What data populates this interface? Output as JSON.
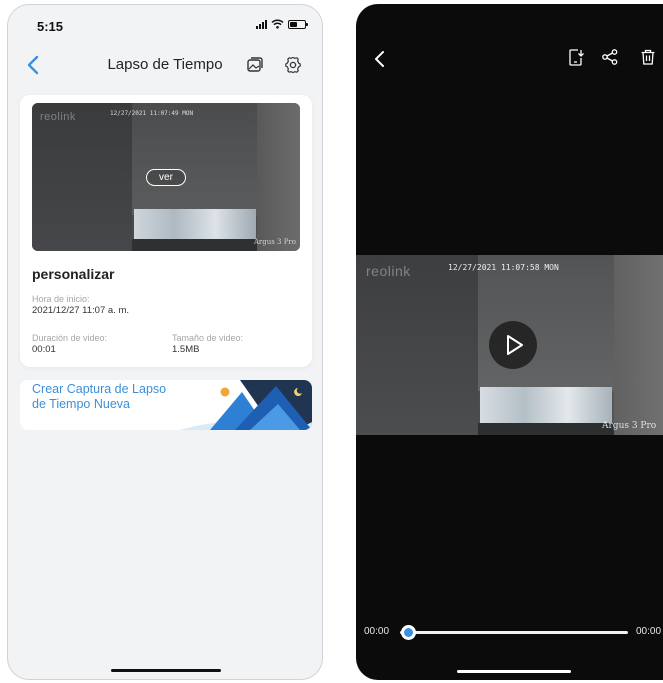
{
  "left_screen": {
    "status_bar": {
      "time": "5:15"
    },
    "header": {
      "title": "Lapso de Tiempo",
      "back_icon": "chevron-left-icon",
      "gallery_icon": "gallery-icon",
      "settings_icon": "gear-icon"
    },
    "card": {
      "thumbnail": {
        "brand": "reolink",
        "timestamp": "12/27/2021 11:07:49 MON",
        "model": "Argus 3 Pro",
        "view_button": "ver"
      },
      "name": "personalizar",
      "start_time_label": "Hora de inicio:",
      "start_time_value": "2021/12/27 11:07 a. m.",
      "duration_label": "Duración de video:",
      "duration_value": "00:01",
      "size_label": "Tamaño de video:",
      "size_value": "1.5MB"
    },
    "create_banner": {
      "label": "Crear Captura de Lapso de Tiempo Nueva"
    }
  },
  "right_screen": {
    "toolbar": {
      "back_icon": "chevron-left-icon",
      "download_icon": "download-to-phone-icon",
      "share_icon": "share-icon",
      "delete_icon": "trash-icon"
    },
    "video": {
      "brand": "reolink",
      "timestamp": "12/27/2021 11:07:58 MON",
      "model": "Argus 3 Pro",
      "play_icon": "play-icon"
    },
    "playback": {
      "current_time": "00:00",
      "total_time": "00:00",
      "progress": 0
    }
  },
  "colors": {
    "accent_blue": "#3a91e0",
    "link_blue": "#3d8fd9",
    "left_background": "#f2f3f5",
    "right_background": "#0b0b0c"
  }
}
